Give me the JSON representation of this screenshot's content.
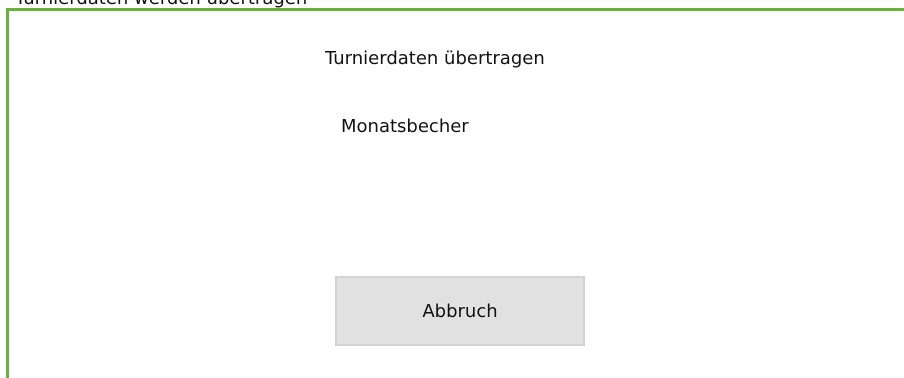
{
  "top_text": "Turnierdaten werden übertragen",
  "dialog": {
    "title": "Turnierdaten übertragen",
    "subtitle": "Monatsbecher",
    "cancel_label": "Abbruch",
    "accent_color": "#67b23a"
  }
}
